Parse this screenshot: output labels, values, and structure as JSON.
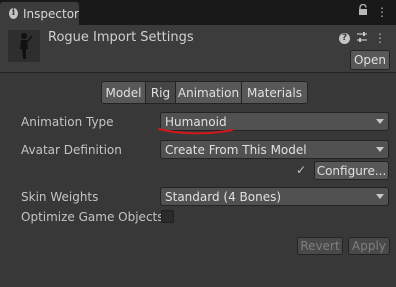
{
  "window": {
    "tab_label": "Inspector",
    "tab_icons": [
      "info-icon",
      "lock-icon",
      "menu-icon"
    ]
  },
  "header": {
    "title": "Rogue Import Settings",
    "open_label": "Open",
    "tool_icons": [
      "help-icon",
      "sliders-icon",
      "kebab-menu-icon"
    ]
  },
  "tabs": [
    {
      "label": "Model",
      "active": false
    },
    {
      "label": "Rig",
      "active": true
    },
    {
      "label": "Animation",
      "active": false
    },
    {
      "label": "Materials",
      "active": false
    }
  ],
  "fields": {
    "animation_type": {
      "label": "Animation Type",
      "value": "Humanoid"
    },
    "avatar_definition": {
      "label": "Avatar Definition",
      "value": "Create From This Model"
    },
    "configure_label": "Configure...",
    "skin_weights": {
      "label": "Skin Weights",
      "value": "Standard (4 Bones)"
    },
    "optimize": {
      "label": "Optimize Game Objects",
      "checked": false
    }
  },
  "footer": {
    "revert_label": "Revert",
    "apply_label": "Apply"
  },
  "colors": {
    "annotation": "#d01818",
    "background": "#383838"
  }
}
